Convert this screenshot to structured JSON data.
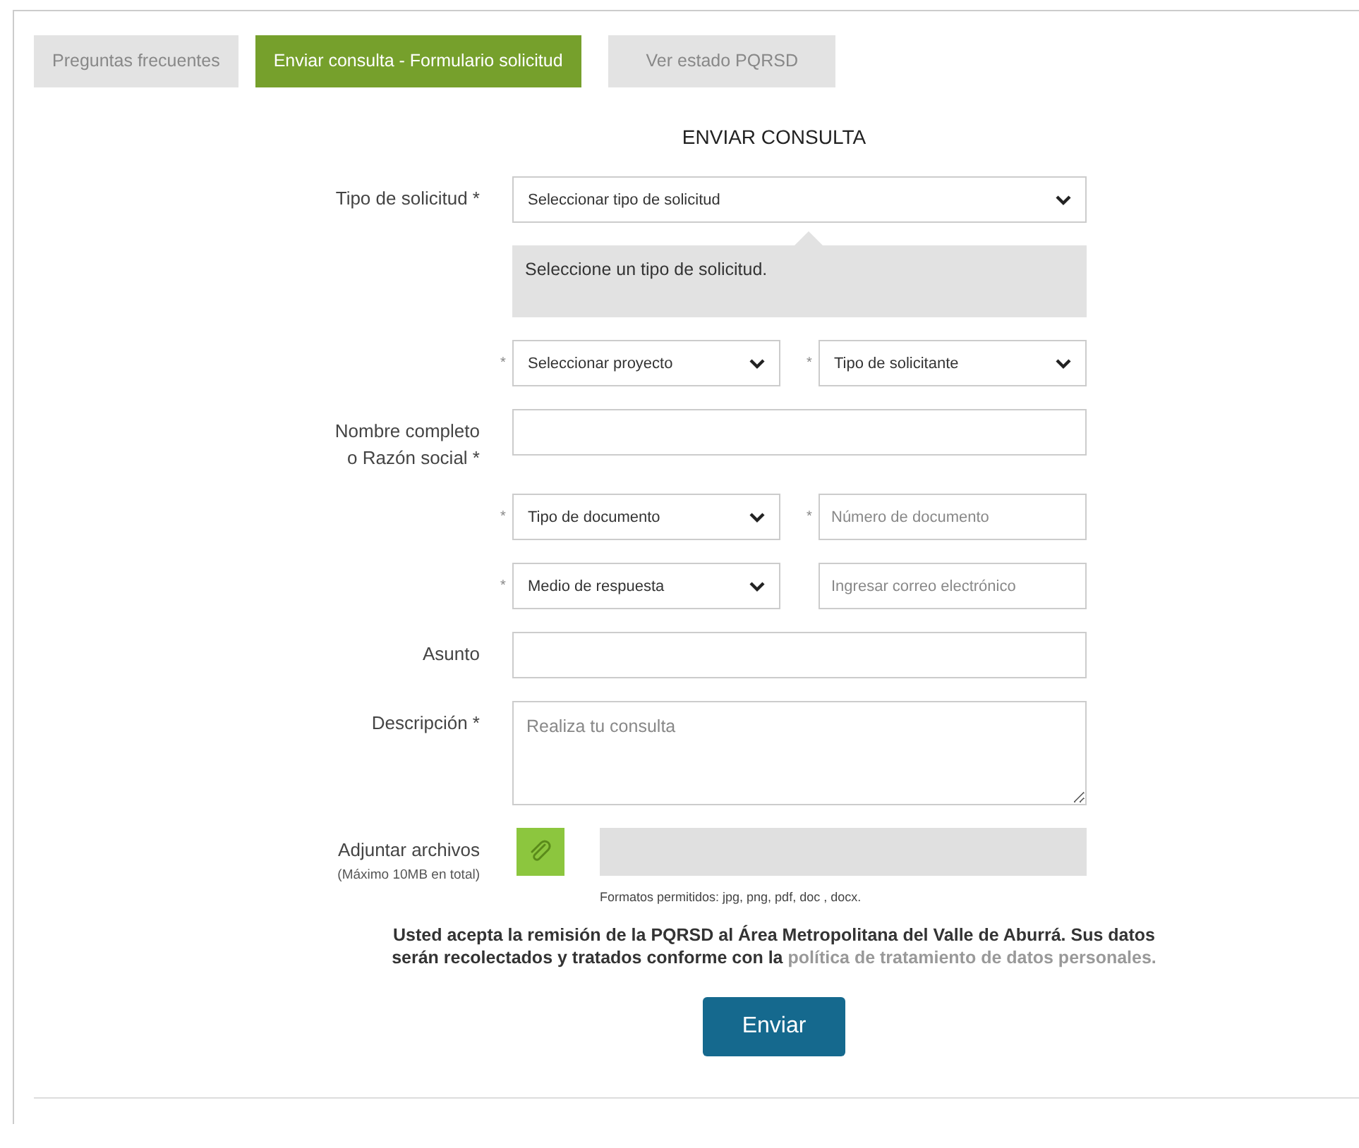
{
  "tabs": [
    {
      "label": "Preguntas frecuentes",
      "selected": false
    },
    {
      "label": "Enviar consulta - Formulario solicitud",
      "selected": true
    },
    {
      "label": "Ver estado PQRSD",
      "selected": false
    }
  ],
  "title": "ENVIAR CONSULTA",
  "rows": [
    {
      "label": "Tipo de solicitud *",
      "controls": [
        {
          "kind": "select",
          "value": "Seleccionar tipo de solicitud"
        }
      ]
    },
    {
      "controls": [
        {
          "kind": "hint",
          "text": "Seleccione un tipo de solicitud."
        }
      ]
    },
    {
      "controls": [
        {
          "kind": "select",
          "prefix": "*",
          "value": "Seleccionar proyecto"
        },
        {
          "kind": "select",
          "prefix": "*",
          "value": "Tipo de solicitante"
        }
      ]
    },
    {
      "label": "Nombre completo o Razón social *",
      "controls": [
        {
          "kind": "input"
        }
      ]
    },
    {
      "controls": [
        {
          "kind": "select",
          "prefix": "*",
          "value": "Tipo de documento"
        },
        {
          "kind": "input",
          "prefix": "*",
          "placeholder": "Número de documento"
        }
      ]
    },
    {
      "controls": [
        {
          "kind": "select",
          "prefix": "*",
          "value": "Medio de respuesta"
        },
        {
          "kind": "input",
          "placeholder": "Ingresar correo electrónico"
        }
      ]
    },
    {
      "label": "Asunto",
      "controls": [
        {
          "kind": "input"
        }
      ]
    },
    {
      "label": "Descripción *",
      "controls": [
        {
          "kind": "textarea",
          "placeholder": "Realiza tu consulta"
        }
      ]
    },
    {
      "label": "Adjuntar archivos",
      "note": "(Máximo 10MB en total)",
      "controls": [
        {
          "kind": "attach",
          "formats": "Formatos permitidos: jpg, png, pdf, doc , docx."
        }
      ]
    }
  ],
  "consent": {
    "text": "Usted acepta la remisión de la PQRSD al Área Metropolitana del Valle de Aburrá. Sus datos serán recolectados y tratados conforme con la",
    "link": "política de tratamiento de datos personales."
  },
  "submit": "Enviar"
}
